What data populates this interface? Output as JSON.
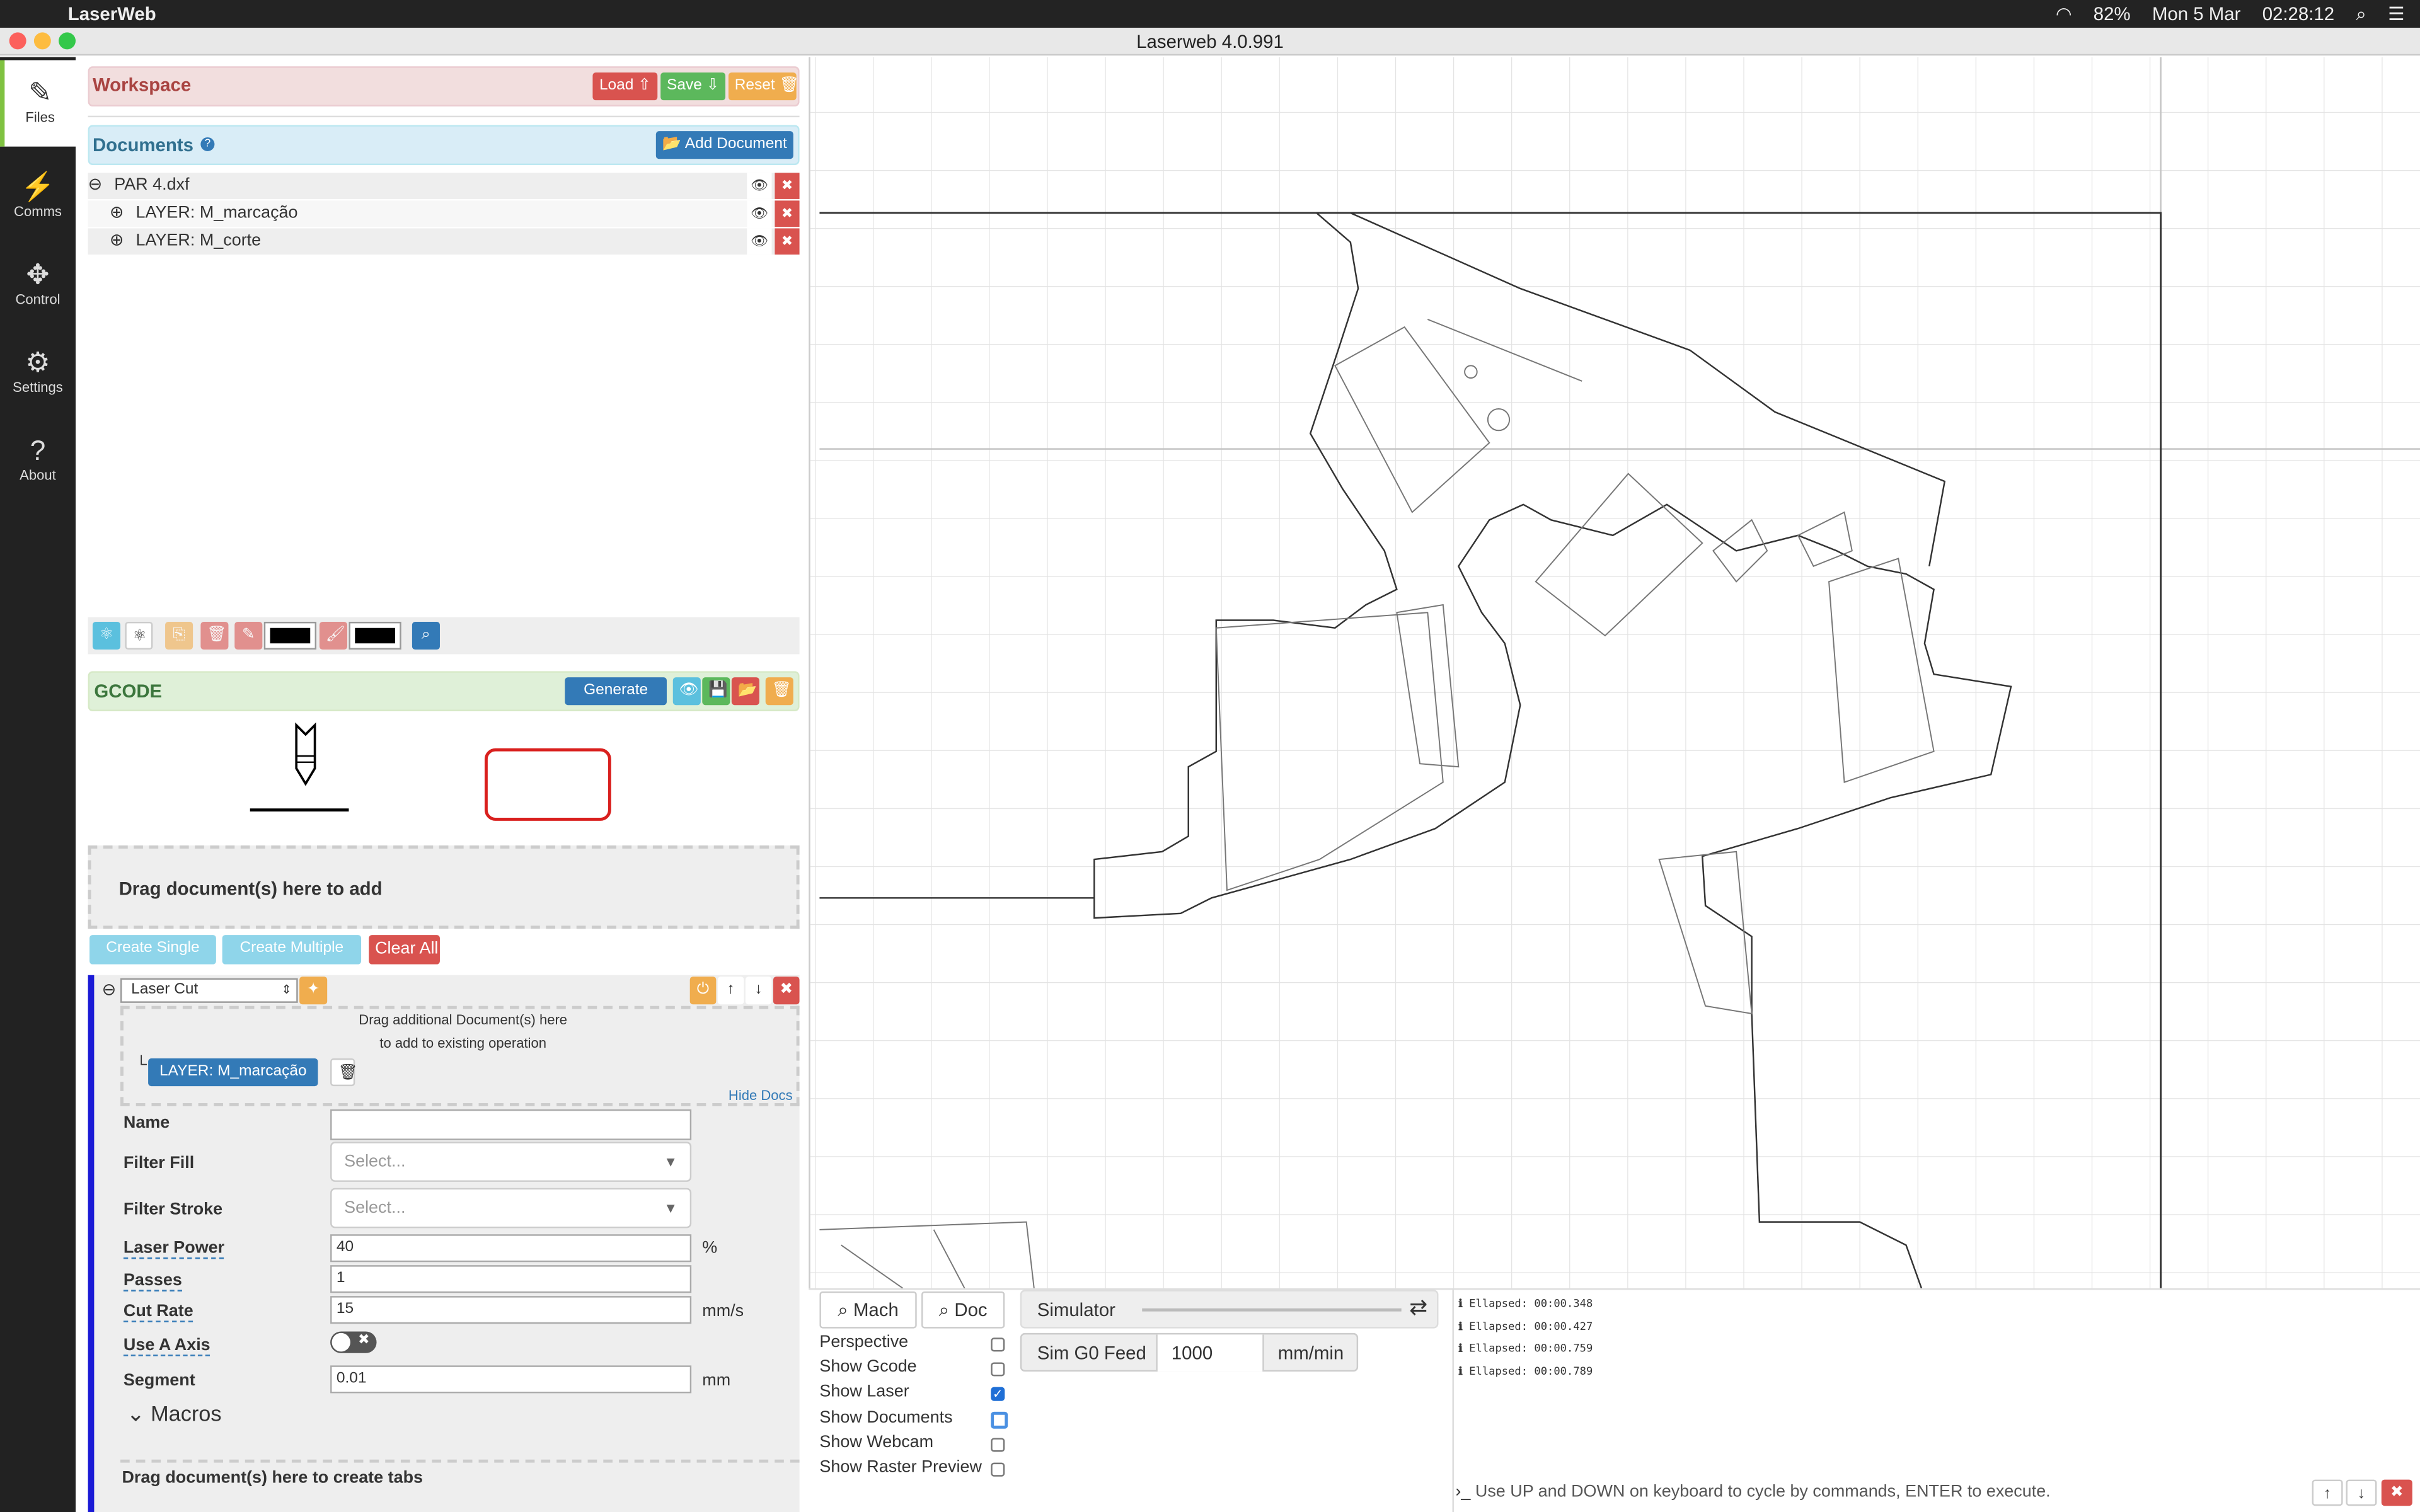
{
  "menubar": {
    "apple": "",
    "app": "LaserWeb",
    "date": "Mon 5 Mar",
    "time": "02:28:12",
    "battery": "82%"
  },
  "window": {
    "title": "Laserweb 4.0.991"
  },
  "nav": [
    {
      "label": "Files",
      "icon": "✎"
    },
    {
      "label": "Comms",
      "icon": "⚡"
    },
    {
      "label": "Control",
      "icon": "✥"
    },
    {
      "label": "Settings",
      "icon": "⚙"
    },
    {
      "label": "About",
      "icon": "?"
    }
  ],
  "workspace": {
    "title": "Workspace",
    "load": "Load ⇧",
    "save": "Save ⇩",
    "reset": "Reset 🗑"
  },
  "documents": {
    "title": "Documents",
    "help": "?",
    "add": "📂 Add Document",
    "items": [
      {
        "label": "PAR 4.dxf",
        "toggle": "⊖"
      },
      {
        "label": "LAYER: M_marcação",
        "toggle": "⊕"
      },
      {
        "label": "LAYER: M_corte",
        "toggle": "⊕"
      }
    ]
  },
  "gcode": {
    "title": "GCODE",
    "generate": "Generate"
  },
  "drop": {
    "add": "Drag document(s) here to add",
    "create_single": "Create Single",
    "create_multiple": "Create Multiple",
    "clear_all": "Clear All"
  },
  "operation": {
    "type": "Laser Cut",
    "drag_line1": "Drag additional Document(s) here",
    "drag_line2": "to add to existing operation",
    "doc_tag": "LAYER: M_marcação",
    "hide_docs": "Hide Docs",
    "name_label": "Name",
    "name_value": "",
    "filter_fill_label": "Filter Fill",
    "filter_fill_value": "Select...",
    "filter_stroke_label": "Filter Stroke",
    "filter_stroke_value": "Select...",
    "power_label": "Laser Power",
    "power_value": "40",
    "power_unit": "%",
    "passes_label": "Passes",
    "passes_value": "1",
    "rate_label": "Cut Rate",
    "rate_value": "15",
    "rate_unit": "mm/s",
    "a_axis_label": "Use A Axis",
    "segment_label": "Segment",
    "segment_value": "0.01",
    "segment_unit": "mm",
    "macros": "Macros",
    "tabs_drop": "Drag document(s) here to create tabs"
  },
  "viewer": {
    "mach": "Mach",
    "doc": "Doc",
    "simulator": "Simulator",
    "feed_label": "Sim G0 Feed",
    "feed_value": "1000",
    "feed_unit": "mm/min",
    "options": [
      {
        "label": "Perspective",
        "checked": false
      },
      {
        "label": "Show Gcode",
        "checked": false
      },
      {
        "label": "Show Laser",
        "checked": true
      },
      {
        "label": "Show Documents",
        "checked": false
      },
      {
        "label": "Show Webcam",
        "checked": false
      },
      {
        "label": "Show Raster Preview",
        "checked": false
      }
    ]
  },
  "console": {
    "lines": [
      "Ellapsed: 00:00.348",
      "Ellapsed: 00:00.427",
      "Ellapsed: 00:00.759",
      "Ellapsed: 00:00.789"
    ],
    "hint": "Use UP and DOWN on keyboard to cycle by commands, ENTER to execute."
  }
}
